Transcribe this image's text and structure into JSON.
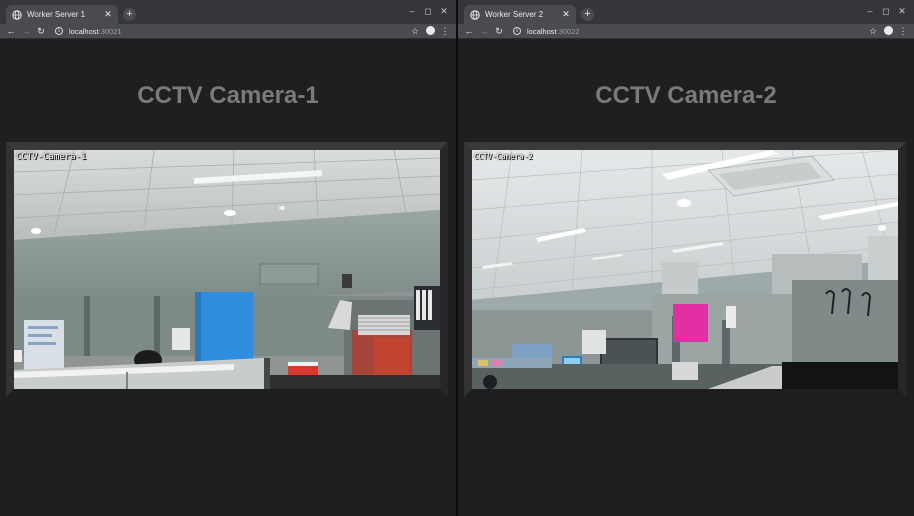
{
  "windows": [
    {
      "tab_title": "Worker Server 1",
      "url_host": "localhost",
      "url_port": ":30021",
      "heading": "CCTV Camera-1",
      "overlay": "CCTV-Camera-1"
    },
    {
      "tab_title": "Worker Server 2",
      "url_host": "localhost",
      "url_port": ":30022",
      "heading": "CCTV Camera-2",
      "overlay": "CCTV-Camera-2"
    }
  ],
  "icons": {
    "tab": "globe-icon",
    "close": "close-icon",
    "new_tab": "plus-icon",
    "back": "back-arrow-icon",
    "forward": "forward-arrow-icon",
    "reload": "reload-icon",
    "info": "info-icon",
    "bookmark": "star-icon",
    "account": "account-icon",
    "menu": "kebab-menu-icon",
    "minimize": "minimize-icon",
    "maximize": "maximize-icon",
    "window_close": "window-close-icon"
  },
  "colors": {
    "page_background": "#1f1f20",
    "heading": "#7a7a7c",
    "tab_strip": "#35363a",
    "toolbar": "#4a4b4f"
  }
}
